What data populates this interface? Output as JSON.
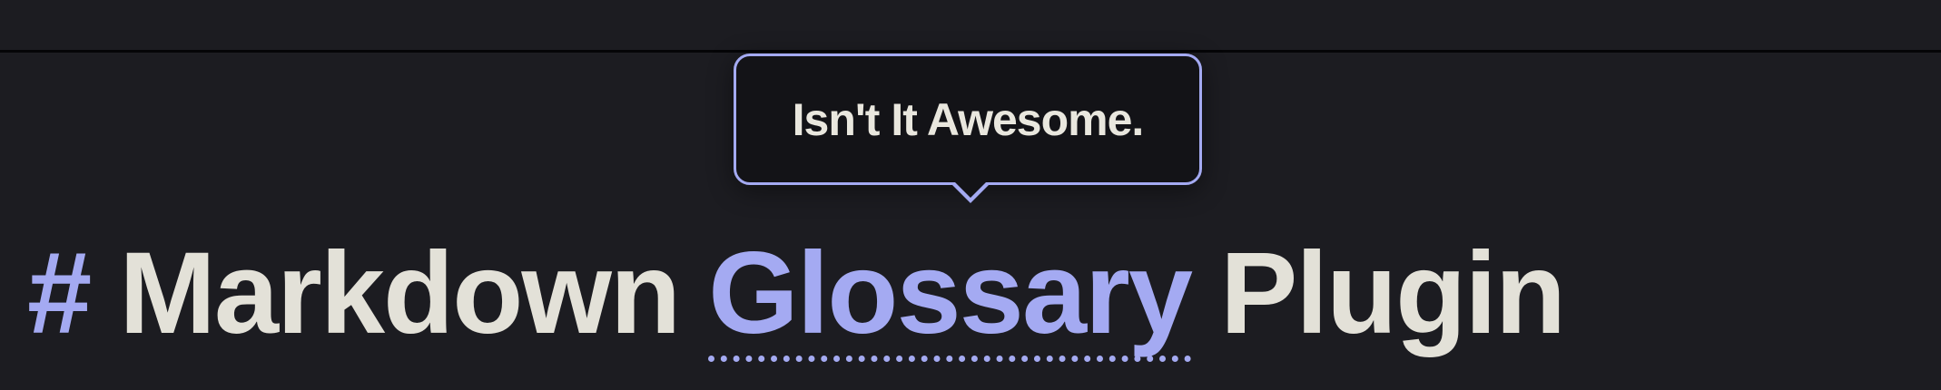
{
  "tooltip": {
    "text": "Isn't It Awesome."
  },
  "heading": {
    "marker": "#",
    "before": "Markdown",
    "term": "Glossary",
    "after": "Plugin"
  },
  "colors": {
    "background": "#1c1c21",
    "accent": "#a4aaf2",
    "text": "#e3e1d8",
    "tooltip_bg": "#131317"
  }
}
